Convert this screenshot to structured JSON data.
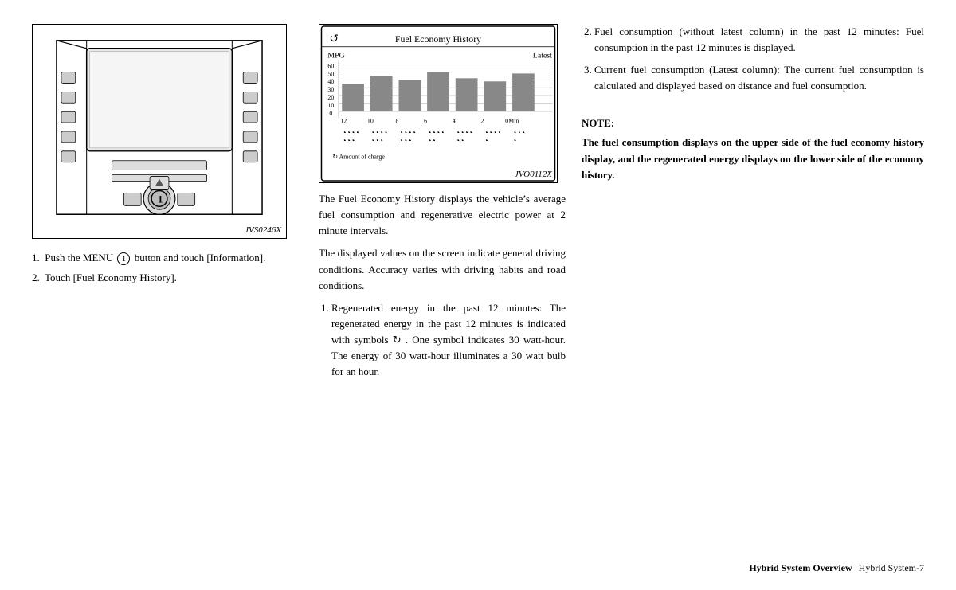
{
  "left": {
    "diagram_label": "JVS0246X",
    "step1": "1.  Push the MENU",
    "step1_circle": "1",
    "step1_cont": "button and touch [Information].",
    "step2": "2.  Touch [Fuel Economy History]."
  },
  "middle": {
    "screen_label": "JVO0112X",
    "screen_title": "Fuel Economy History",
    "screen_mpg": "MPG",
    "screen_latest": "Latest",
    "screen_y_values": [
      "60",
      "50",
      "40",
      "30",
      "20",
      "10",
      "0"
    ],
    "screen_x_values": [
      "12",
      "10",
      "8",
      "6",
      "4",
      "2",
      "0Min"
    ],
    "screen_charge": "Amount of charge",
    "para1": "The Fuel Economy History displays the vehicle’s average fuel consumption and regenerative electric power at 2 minute intervals.",
    "para2": "The displayed values on the screen indicate general driving conditions. Accuracy varies with driving habits and road conditions.",
    "list_item1_label": "1.",
    "list_item1": "Regenerated energy in the past 12 minutes: The regenerated energy in the past 12 minutes is indicated with symbols",
    "list_item1_cont": ". One symbol indicates 30 watt-hour. The energy of 30 watt-hour illuminates a 30 watt bulb for an hour."
  },
  "right": {
    "item2": "Fuel consumption (without latest column) in the past 12 minutes: Fuel consumption in the past 12 minutes is displayed.",
    "item3": "Current fuel consumption (Latest column): The current fuel consumption is calculated and displayed based on distance and fuel consumption.",
    "note_label": "NOTE:",
    "note_text": "The fuel consumption displays on the upper side of the fuel economy history display, and the regenerated energy displays on the lower side of the economy history."
  },
  "footer": {
    "left": "Hybrid System Overview",
    "right": "Hybrid System-7"
  }
}
